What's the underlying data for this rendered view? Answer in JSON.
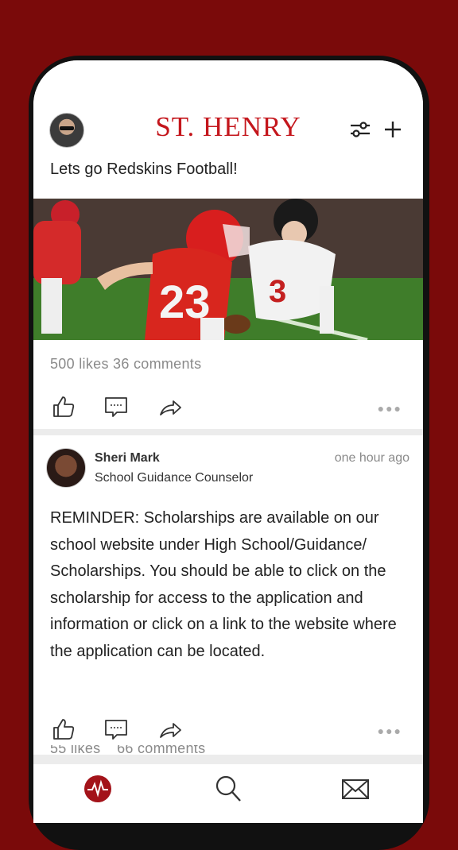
{
  "header": {
    "brand": "ST. HENRY",
    "icons": {
      "filter": "sliders-icon",
      "add": "plus-icon",
      "avatar": "user-avatar"
    }
  },
  "posts": [
    {
      "caption": "Lets go Redskins Football!",
      "stats": "500 likes 36 comments",
      "actions": [
        "like-icon",
        "comment-icon",
        "share-icon",
        "more-icon"
      ]
    },
    {
      "author": "Sheri Mark",
      "role": "School Guidance Counselor",
      "time": "one hour ago",
      "text": "REMINDER: Scholarships are available on our school website under High School/Guidance/ Scholarships. You should be able to click on the scholarship for access to the application and information or click on a link to the website where the application can be located.",
      "likes": "55 likes",
      "comments": "66 comments",
      "actions": [
        "like-icon",
        "comment-icon",
        "share-icon",
        "more-icon"
      ]
    }
  ],
  "tabbar": {
    "items": [
      "activity-icon",
      "search-icon",
      "mail-icon"
    ]
  },
  "colors": {
    "brand": "#c4161c",
    "background": "#7a0a0a"
  }
}
